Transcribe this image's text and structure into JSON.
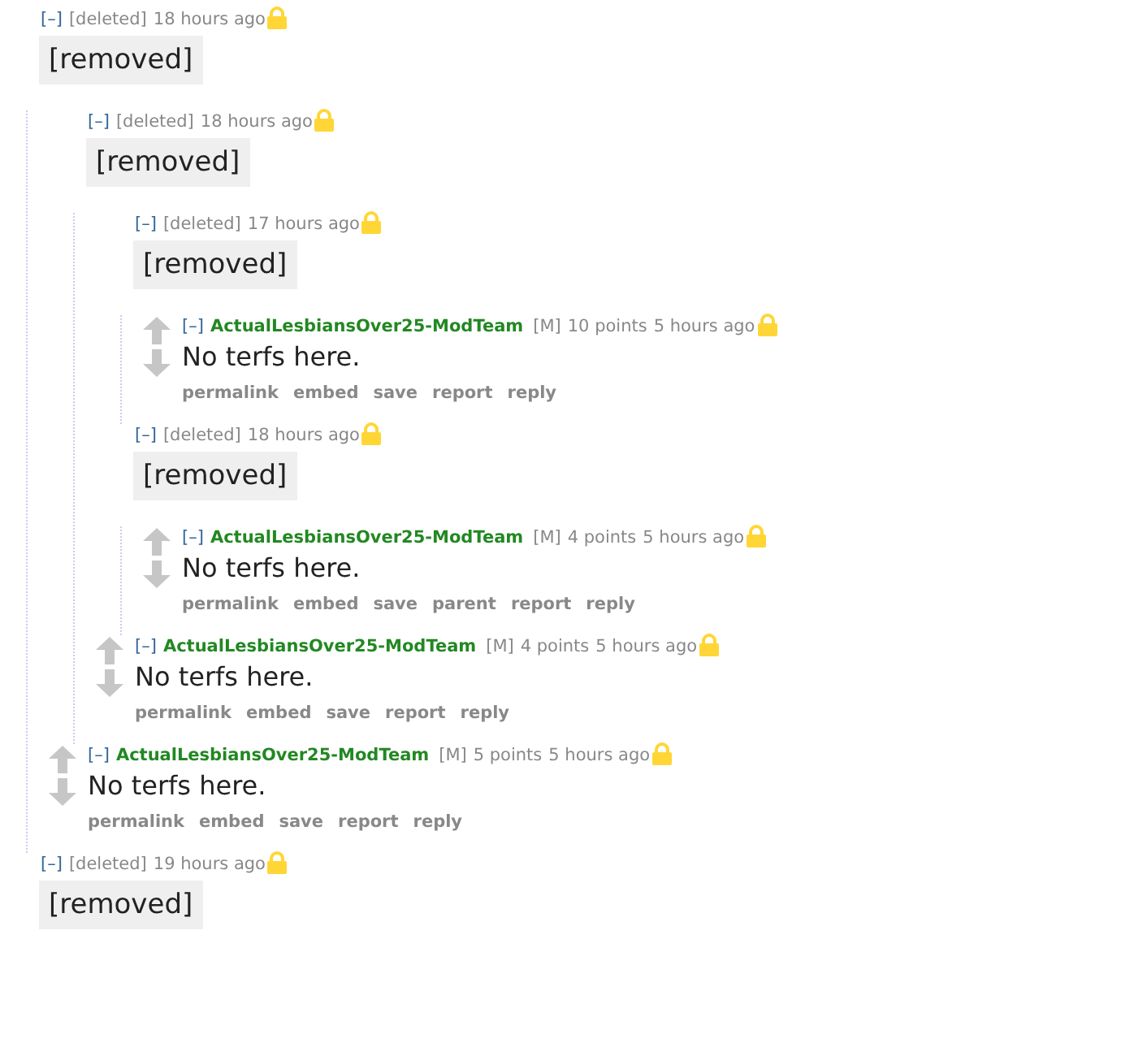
{
  "comments": [
    {
      "kind": "deleted",
      "toggle": "[–]",
      "author": "[deleted]",
      "time": "18 hours ago",
      "locked": true,
      "body": "[removed]",
      "children": [
        {
          "kind": "deleted",
          "toggle": "[–]",
          "author": "[deleted]",
          "time": "18 hours ago",
          "locked": true,
          "body": "[removed]",
          "children": [
            {
              "kind": "deleted",
              "toggle": "[–]",
              "author": "[deleted]",
              "time": "17 hours ago",
              "locked": true,
              "body": "[removed]",
              "children": [
                {
                  "kind": "vote",
                  "toggle": "[–]",
                  "author": "ActualLesbiansOver25-ModTeam",
                  "flair": "[M]",
                  "score": "10 points",
                  "time": "5 hours ago",
                  "locked": true,
                  "body": "No terfs here.",
                  "actions": [
                    "permalink",
                    "embed",
                    "save",
                    "report",
                    "reply"
                  ]
                }
              ]
            },
            {
              "kind": "deleted",
              "toggle": "[–]",
              "author": "[deleted]",
              "time": "18 hours ago",
              "locked": true,
              "body": "[removed]",
              "children": [
                {
                  "kind": "vote",
                  "toggle": "[–]",
                  "author": "ActualLesbiansOver25-ModTeam",
                  "flair": "[M]",
                  "score": "4 points",
                  "time": "5 hours ago",
                  "locked": true,
                  "body": "No terfs here.",
                  "actions": [
                    "permalink",
                    "embed",
                    "save",
                    "parent",
                    "report",
                    "reply"
                  ]
                }
              ]
            },
            {
              "kind": "vote",
              "toggle": "[–]",
              "author": "ActualLesbiansOver25-ModTeam",
              "flair": "[M]",
              "score": "4 points",
              "time": "5 hours ago",
              "locked": true,
              "body": "No terfs here.",
              "actions": [
                "permalink",
                "embed",
                "save",
                "report",
                "reply"
              ]
            }
          ]
        },
        {
          "kind": "vote",
          "toggle": "[–]",
          "author": "ActualLesbiansOver25-ModTeam",
          "flair": "[M]",
          "score": "5 points",
          "time": "5 hours ago",
          "locked": true,
          "body": "No terfs here.",
          "actions": [
            "permalink",
            "embed",
            "save",
            "report",
            "reply"
          ]
        }
      ]
    },
    {
      "kind": "deleted",
      "toggle": "[–]",
      "author": "[deleted]",
      "time": "19 hours ago",
      "locked": true,
      "body": "[removed]"
    }
  ]
}
